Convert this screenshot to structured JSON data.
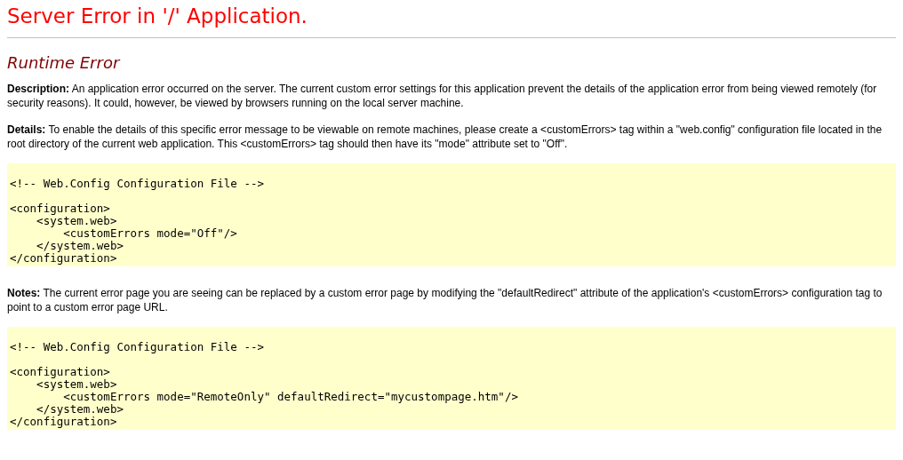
{
  "title": "Server Error in '/' Application.",
  "heading": "Runtime Error",
  "sections": [
    {
      "kind": "paragraph",
      "label": "Description:",
      "text": "An application error occurred on the server. The current custom error settings for this application prevent the details of the application error from being viewed remotely (for security reasons). It could, however, be viewed by browsers running on the local server machine."
    },
    {
      "kind": "paragraph",
      "label": "Details:",
      "text": "To enable the details of this specific error message to be viewable on remote machines, please create a <customErrors> tag within a \"web.config\" configuration file located in the root directory of the current web application. This <customErrors> tag should then have its \"mode\" attribute set to \"Off\"."
    },
    {
      "kind": "code",
      "comment": "<!-- Web.Config Configuration File -->",
      "lines": [
        "<configuration>",
        "    <system.web>",
        "        <customErrors mode=\"Off\"/>",
        "    </system.web>",
        "</configuration>"
      ]
    },
    {
      "kind": "paragraph",
      "label": "Notes:",
      "text": "The current error page you are seeing can be replaced by a custom error page by modifying the \"defaultRedirect\" attribute of the application's <customErrors> configuration tag to point to a custom error page URL."
    },
    {
      "kind": "code",
      "comment": "<!-- Web.Config Configuration File -->",
      "lines": [
        "<configuration>",
        "    <system.web>",
        "        <customErrors mode=\"RemoteOnly\" defaultRedirect=\"mycustompage.htm\"/>",
        "    </system.web>",
        "</configuration>"
      ]
    }
  ]
}
